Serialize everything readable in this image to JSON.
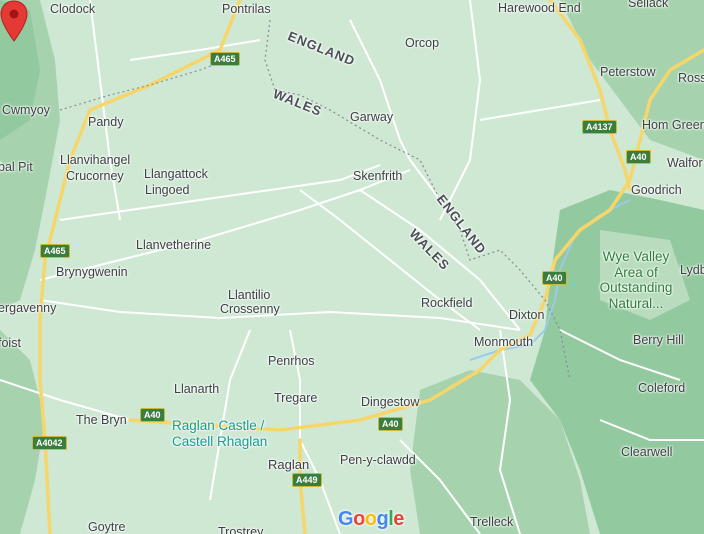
{
  "map": {
    "places": [
      {
        "id": "clodock",
        "text": "Clodock"
      },
      {
        "id": "pontrilas",
        "text": "Pontrilas"
      },
      {
        "id": "harewood-end",
        "text": "Harewood End"
      },
      {
        "id": "sellack",
        "text": "Sellack"
      },
      {
        "id": "orcop",
        "text": "Orcop"
      },
      {
        "id": "cwmyoy",
        "text": "Cwmyoy"
      },
      {
        "id": "peterstow",
        "text": "Peterstow"
      },
      {
        "id": "ross",
        "text": "Ross"
      },
      {
        "id": "pandy",
        "text": "Pandy"
      },
      {
        "id": "garway",
        "text": "Garway"
      },
      {
        "id": "hom-green",
        "text": "Hom Green"
      },
      {
        "id": "pal-pit",
        "text": "bal Pit"
      },
      {
        "id": "llanvihangel",
        "text": "Llanvihangel"
      },
      {
        "id": "crucorney",
        "text": "Crucorney"
      },
      {
        "id": "llangattock",
        "text": "Llangattock"
      },
      {
        "id": "lingoed",
        "text": "Lingoed"
      },
      {
        "id": "skenfrith",
        "text": "Skenfrith"
      },
      {
        "id": "walford",
        "text": "Walfor"
      },
      {
        "id": "goodrich",
        "text": "Goodrich"
      },
      {
        "id": "llanvetherine",
        "text": "Llanvetherine"
      },
      {
        "id": "brynygwenin",
        "text": "Brynygwenin"
      },
      {
        "id": "abergavenny",
        "text": "ergavenny"
      },
      {
        "id": "llantilio",
        "text": "Llantilio"
      },
      {
        "id": "crossenny",
        "text": "Crossenny"
      },
      {
        "id": "rockfield",
        "text": "Rockfield"
      },
      {
        "id": "dixton",
        "text": "Dixton"
      },
      {
        "id": "monmouth",
        "text": "Monmouth"
      },
      {
        "id": "berry-hill",
        "text": "Berry Hill"
      },
      {
        "id": "lydb",
        "text": "Lydb"
      },
      {
        "id": "lafoist",
        "text": "foist"
      },
      {
        "id": "penrhos",
        "text": "Penrhos"
      },
      {
        "id": "llanarth",
        "text": "Llanarth"
      },
      {
        "id": "tregare",
        "text": "Tregare"
      },
      {
        "id": "dingestow",
        "text": "Dingestow"
      },
      {
        "id": "coleford",
        "text": "Coleford"
      },
      {
        "id": "the-bryn",
        "text": "The Bryn"
      },
      {
        "id": "raglan",
        "text": "Raglan"
      },
      {
        "id": "pen-y-clawdd",
        "text": "Pen-y-clawdd"
      },
      {
        "id": "clearwell",
        "text": "Clearwell"
      },
      {
        "id": "goytre",
        "text": "Goytre"
      },
      {
        "id": "trostrey",
        "text": "Trostrey"
      },
      {
        "id": "trelleck",
        "text": "Trelleck"
      }
    ],
    "regions": [
      {
        "id": "england-1",
        "text": "ENGLAND"
      },
      {
        "id": "wales-1",
        "text": "WALES"
      },
      {
        "id": "england-2",
        "text": "ENGLAND"
      },
      {
        "id": "wales-2",
        "text": "WALES"
      }
    ],
    "aonb": {
      "line1": "Wye Valley",
      "line2": "Area of",
      "line3": "Outstanding",
      "line4": "Natural..."
    },
    "poi": {
      "line1": "Raglan Castle /",
      "line2": "Castell Rhaglan"
    },
    "shields": [
      {
        "id": "a465-north",
        "text": "A465"
      },
      {
        "id": "a465-west",
        "text": "A465"
      },
      {
        "id": "a4137",
        "text": "A4137"
      },
      {
        "id": "a40-east-1",
        "text": "A40"
      },
      {
        "id": "a40-east-2",
        "text": "A40"
      },
      {
        "id": "a40-raglan",
        "text": "A40"
      },
      {
        "id": "a40-dingestow",
        "text": "A40"
      },
      {
        "id": "a4042",
        "text": "A4042"
      },
      {
        "id": "a449",
        "text": "A449"
      }
    ],
    "logo": {
      "letters": [
        "G",
        "o",
        "o",
        "g",
        "l",
        "e"
      ],
      "colors": [
        "#4285F4",
        "#EA4335",
        "#FBBC05",
        "#4285F4",
        "#34A853",
        "#EA4335"
      ]
    },
    "colors": {
      "land": "#cfe8d4",
      "forest": "#8fc79b",
      "road": "#ffffff",
      "major_road": "#f6d66a",
      "pin": "#e53935"
    }
  }
}
